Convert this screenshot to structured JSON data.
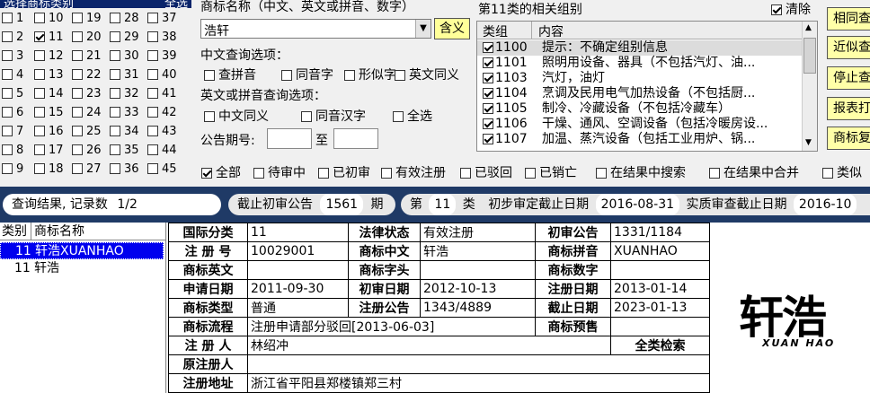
{
  "class_panel": {
    "header": "选择商标类别",
    "header_right": "全选",
    "columns": [
      [
        "1",
        "2",
        "3",
        "4",
        "5",
        "6",
        "7",
        "8",
        "9"
      ],
      [
        "10",
        "11",
        "12",
        "13",
        "14",
        "15",
        "16",
        "17",
        "18"
      ],
      [
        "19",
        "20",
        "21",
        "22",
        "23",
        "24",
        "25",
        "26",
        "27"
      ],
      [
        "28",
        "29",
        "30",
        "31",
        "32",
        "33",
        "34",
        "35",
        "36"
      ],
      [
        "37",
        "38",
        "39",
        "40",
        "41",
        "42",
        "43",
        "44",
        "45"
      ]
    ],
    "checked": [
      "11"
    ]
  },
  "search": {
    "name_label": "商标名称（中文、英文或拼音、数字）",
    "name_value": "浩轩",
    "hanyi_button": "含义",
    "cn_options_label": "中文查询选项：",
    "cn_options": [
      "查拼音",
      "同音字",
      "形似字",
      "英文同义"
    ],
    "en_options_label": "英文或拼音查询选项：",
    "en_options": [
      "中文同义",
      "同音汉字",
      "全选"
    ],
    "gazette_label": "公告期号:",
    "to_label": "至"
  },
  "groups": {
    "title": "第11类的相关组别",
    "clear_label": "清除",
    "col_group": "类组",
    "col_content": "内容",
    "rows": [
      {
        "code": "1100",
        "text": "提示：不确定组别信息"
      },
      {
        "code": "1101",
        "text": "照明用设备、器具（不包括汽灯、油..."
      },
      {
        "code": "1103",
        "text": "汽灯，油灯"
      },
      {
        "code": "1104",
        "text": "烹调及民用电气加热设备（不包括厨..."
      },
      {
        "code": "1105",
        "text": "制冷、冷藏设备（不包括冷藏车）"
      },
      {
        "code": "1106",
        "text": "干燥、通风、空调设备（包括冷暖房设..."
      },
      {
        "code": "1107",
        "text": "加温、蒸汽设备（包括工业用炉、锅..."
      }
    ]
  },
  "right_buttons": [
    "相同查",
    "近似查",
    "停止查",
    "报表打",
    "商标复"
  ],
  "filters": [
    "全部",
    "待审中",
    "已初审",
    "有效注册",
    "已驳回",
    "已销亡",
    "在结果中搜索",
    "在结果中合并",
    "类似"
  ],
  "status_bar": {
    "result_label": "查询结果, 记录数",
    "result_value": "1/2",
    "cutoff_label": "截止初审公告",
    "cutoff_value": "1561",
    "cutoff_unit": "期",
    "class_prefix": "第",
    "class_value": "11",
    "class_suffix": "类",
    "prelim_label": "初步审定截止日期",
    "prelim_value": "2016-08-31",
    "subst_label": "实质审查截止日期",
    "subst_value": "2016-10"
  },
  "results": {
    "col_class": "类别",
    "col_name": "商标名称",
    "rows": [
      {
        "cls": "11",
        "name": "轩浩XUANHAO"
      },
      {
        "cls": "11",
        "name": "轩浩"
      }
    ]
  },
  "detail": {
    "intl_class_label": "国际分类",
    "intl_class": "11",
    "legal_status_label": "法律状态",
    "legal_status": "有效注册",
    "prelim_gazette_label": "初审公告",
    "prelim_gazette": "1331/1184",
    "reg_no_label": "注 册 号",
    "reg_no": "10029001",
    "cn_label": "商标中文",
    "cn": "轩浩",
    "pinyin_label": "商标拼音",
    "pinyin": "XUANHAO",
    "en_label": "商标英文",
    "en": "",
    "head_label": "商标字头",
    "head": "",
    "digit_label": "商标数字",
    "digit": "",
    "apply_date_label": "申请日期",
    "apply_date": "2011-09-30",
    "prelim_date_label": "初审日期",
    "prelim_date": "2012-10-13",
    "reg_date_label": "注册日期",
    "reg_date": "2013-01-14",
    "type_label": "商标类型",
    "type": "普通",
    "reg_gazette_label": "注册公告",
    "reg_gazette": "1343/4889",
    "expire_label": "截止日期",
    "expire": "2023-01-13",
    "flow_label": "商标流程",
    "flow": "注册申请部分驳回[2013-06-03]",
    "warn_label": "商标预售",
    "warn": "",
    "registrant_label": "注 册 人",
    "registrant": "林绍冲",
    "all_search": "全类检索",
    "orig_registrant_label": "原注册人",
    "orig_registrant": "",
    "address_label": "注册地址",
    "address": "浙江省平阳县郑楼镇郑三村"
  },
  "logo": {
    "main": "轩浩",
    "sub": "XUAN HAO"
  }
}
